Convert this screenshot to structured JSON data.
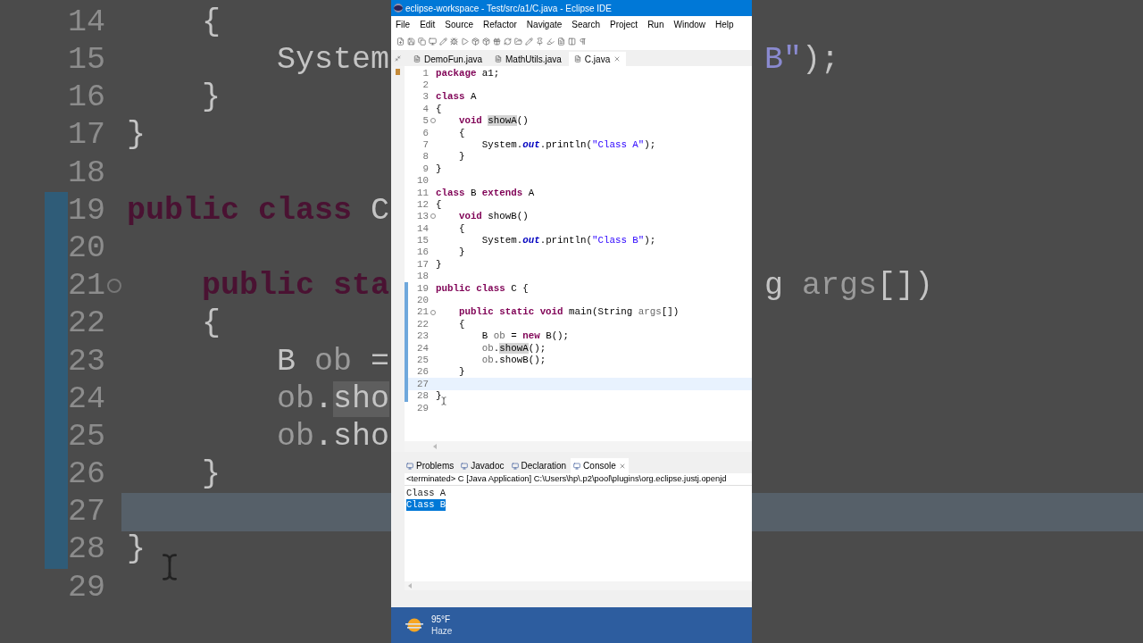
{
  "backdrop": {
    "left_lines": [
      {
        "number": "14",
        "fold": false,
        "changed": false,
        "current": false,
        "tokens": [
          {
            "text": "    {",
            "kind": "plain"
          }
        ]
      },
      {
        "number": "15",
        "fold": false,
        "changed": false,
        "current": false,
        "tokens": [
          {
            "text": "        System",
            "kind": "plain"
          }
        ]
      },
      {
        "number": "16",
        "fold": false,
        "changed": false,
        "current": false,
        "tokens": [
          {
            "text": "    }",
            "kind": "plain"
          }
        ]
      },
      {
        "number": "17",
        "fold": false,
        "changed": false,
        "current": false,
        "tokens": [
          {
            "text": "}",
            "kind": "plain"
          }
        ]
      },
      {
        "number": "18",
        "fold": false,
        "changed": false,
        "current": false
      },
      {
        "number": "19",
        "fold": false,
        "changed": true,
        "current": false,
        "tokens": [
          {
            "text": "public class",
            "kind": "keyword"
          },
          {
            "text": " C",
            "kind": "plain"
          }
        ]
      },
      {
        "number": "20",
        "fold": false,
        "changed": true,
        "current": false
      },
      {
        "number": "21",
        "fold": true,
        "changed": true,
        "current": false,
        "tokens": [
          {
            "text": "    public sta",
            "kind": "keyword"
          }
        ]
      },
      {
        "number": "22",
        "fold": false,
        "changed": true,
        "current": false,
        "tokens": [
          {
            "text": "    {",
            "kind": "plain"
          }
        ]
      },
      {
        "number": "23",
        "fold": false,
        "changed": true,
        "current": false,
        "tokens": [
          {
            "text": "        B ",
            "kind": "plain"
          },
          {
            "text": "ob",
            "kind": "local"
          },
          {
            "text": " =",
            "kind": "plain"
          }
        ]
      },
      {
        "number": "24",
        "fold": false,
        "changed": true,
        "current": false,
        "tokens": [
          {
            "text": "        ob",
            "kind": "local"
          },
          {
            "text": ".",
            "kind": "plain"
          },
          {
            "text": "sho",
            "kind": "occurrence"
          }
        ]
      },
      {
        "number": "25",
        "fold": false,
        "changed": true,
        "current": false,
        "tokens": [
          {
            "text": "        ob",
            "kind": "local"
          },
          {
            "text": ".sho",
            "kind": "plain"
          }
        ]
      },
      {
        "number": "26",
        "fold": false,
        "changed": true,
        "current": false,
        "tokens": [
          {
            "text": "    }",
            "kind": "plain"
          }
        ]
      },
      {
        "number": "27",
        "fold": false,
        "changed": true,
        "current": true
      },
      {
        "number": "28",
        "fold": false,
        "changed": true,
        "current": false,
        "tokens": [
          {
            "text": "}",
            "kind": "plain"
          }
        ]
      },
      {
        "number": "29",
        "fold": false,
        "changed": false,
        "current": false
      }
    ],
    "right_lines": [
      {
        "current": false
      },
      {
        "current": false,
        "tokens": [
          {
            "text": "B\"",
            "kind": "string"
          },
          {
            "text": ");",
            "kind": "plain"
          }
        ]
      },
      {
        "current": false
      },
      {
        "current": false
      },
      {
        "current": false
      },
      {
        "current": false
      },
      {
        "current": false
      },
      {
        "current": false,
        "tokens": [
          {
            "text": "g ",
            "kind": "plain"
          },
          {
            "text": "args",
            "kind": "local"
          },
          {
            "text": "[])",
            "kind": "plain"
          }
        ]
      },
      {
        "current": false
      },
      {
        "current": false
      },
      {
        "current": false
      },
      {
        "current": false
      },
      {
        "current": false
      },
      {
        "current": true
      },
      {
        "current": false
      },
      {
        "current": false
      }
    ]
  },
  "window": {
    "title": "eclipse-workspace - Test/src/a1/C.java - Eclipse IDE"
  },
  "menu": [
    "File",
    "Edit",
    "Source",
    "Refactor",
    "Navigate",
    "Search",
    "Project",
    "Run",
    "Window",
    "Help"
  ],
  "editor_tabs": [
    {
      "label": "DemoFun.java",
      "selected": false
    },
    {
      "label": "MathUtils.java",
      "selected": false
    },
    {
      "label": "C.java",
      "selected": true
    }
  ],
  "code": [
    {
      "number": "1",
      "fold": false,
      "changed": false,
      "current": false,
      "tokens": [
        {
          "text": "package",
          "kind": "keyword"
        },
        {
          "text": " a1;",
          "kind": "plain"
        }
      ]
    },
    {
      "number": "2",
      "fold": false,
      "changed": false,
      "current": false
    },
    {
      "number": "3",
      "fold": false,
      "changed": false,
      "current": false,
      "tokens": [
        {
          "text": "class",
          "kind": "keyword"
        },
        {
          "text": " A",
          "kind": "plain"
        }
      ]
    },
    {
      "number": "4",
      "fold": false,
      "changed": false,
      "current": false,
      "tokens": [
        {
          "text": "{",
          "kind": "plain"
        }
      ]
    },
    {
      "number": "5",
      "fold": true,
      "changed": false,
      "current": false,
      "tokens": [
        {
          "text": "    void ",
          "kind": "keyword"
        },
        {
          "text": "showA",
          "kind": "occurrence"
        },
        {
          "text": "()",
          "kind": "plain"
        }
      ]
    },
    {
      "number": "6",
      "fold": false,
      "changed": false,
      "current": false,
      "tokens": [
        {
          "text": "    {",
          "kind": "plain"
        }
      ]
    },
    {
      "number": "7",
      "fold": false,
      "changed": false,
      "current": false,
      "tokens": [
        {
          "text": "        System.",
          "kind": "plain"
        },
        {
          "text": "out",
          "kind": "field"
        },
        {
          "text": ".println(",
          "kind": "plain"
        },
        {
          "text": "\"Class A\"",
          "kind": "string"
        },
        {
          "text": ");",
          "kind": "plain"
        }
      ]
    },
    {
      "number": "8",
      "fold": false,
      "changed": false,
      "current": false,
      "tokens": [
        {
          "text": "    }",
          "kind": "plain"
        }
      ]
    },
    {
      "number": "9",
      "fold": false,
      "changed": false,
      "current": false,
      "tokens": [
        {
          "text": "}",
          "kind": "plain"
        }
      ]
    },
    {
      "number": "10",
      "fold": false,
      "changed": false,
      "current": false
    },
    {
      "number": "11",
      "fold": false,
      "changed": false,
      "current": false,
      "tokens": [
        {
          "text": "class",
          "kind": "keyword"
        },
        {
          "text": " B ",
          "kind": "plain"
        },
        {
          "text": "extends",
          "kind": "keyword"
        },
        {
          "text": " A",
          "kind": "plain"
        }
      ]
    },
    {
      "number": "12",
      "fold": false,
      "changed": false,
      "current": false,
      "tokens": [
        {
          "text": "{",
          "kind": "plain"
        }
      ]
    },
    {
      "number": "13",
      "fold": true,
      "changed": false,
      "current": false,
      "tokens": [
        {
          "text": "    void",
          "kind": "keyword"
        },
        {
          "text": " showB()",
          "kind": "plain"
        }
      ]
    },
    {
      "number": "14",
      "fold": false,
      "changed": false,
      "current": false,
      "tokens": [
        {
          "text": "    {",
          "kind": "plain"
        }
      ]
    },
    {
      "number": "15",
      "fold": false,
      "changed": false,
      "current": false,
      "tokens": [
        {
          "text": "        System.",
          "kind": "plain"
        },
        {
          "text": "out",
          "kind": "field"
        },
        {
          "text": ".println(",
          "kind": "plain"
        },
        {
          "text": "\"Class B\"",
          "kind": "string"
        },
        {
          "text": ");",
          "kind": "plain"
        }
      ]
    },
    {
      "number": "16",
      "fold": false,
      "changed": false,
      "current": false,
      "tokens": [
        {
          "text": "    }",
          "kind": "plain"
        }
      ]
    },
    {
      "number": "17",
      "fold": false,
      "changed": false,
      "current": false,
      "tokens": [
        {
          "text": "}",
          "kind": "plain"
        }
      ]
    },
    {
      "number": "18",
      "fold": false,
      "changed": false,
      "current": false
    },
    {
      "number": "19",
      "fold": false,
      "changed": true,
      "current": false,
      "tokens": [
        {
          "text": "public class",
          "kind": "keyword"
        },
        {
          "text": " C {",
          "kind": "plain"
        }
      ]
    },
    {
      "number": "20",
      "fold": false,
      "changed": true,
      "current": false
    },
    {
      "number": "21",
      "fold": true,
      "changed": true,
      "current": false,
      "tokens": [
        {
          "text": "    public static void",
          "kind": "keyword"
        },
        {
          "text": " main(String ",
          "kind": "plain"
        },
        {
          "text": "args",
          "kind": "local"
        },
        {
          "text": "[])",
          "kind": "plain"
        }
      ]
    },
    {
      "number": "22",
      "fold": false,
      "changed": true,
      "current": false,
      "tokens": [
        {
          "text": "    {",
          "kind": "plain"
        }
      ]
    },
    {
      "number": "23",
      "fold": false,
      "changed": true,
      "current": false,
      "tokens": [
        {
          "text": "        B ",
          "kind": "plain"
        },
        {
          "text": "ob",
          "kind": "local"
        },
        {
          "text": " = ",
          "kind": "plain"
        },
        {
          "text": "new",
          "kind": "keyword"
        },
        {
          "text": " B();",
          "kind": "plain"
        }
      ]
    },
    {
      "number": "24",
      "fold": false,
      "changed": true,
      "current": false,
      "tokens": [
        {
          "text": "        ob",
          "kind": "local"
        },
        {
          "text": ".",
          "kind": "plain"
        },
        {
          "text": "showA",
          "kind": "occurrence"
        },
        {
          "text": "();",
          "kind": "plain"
        }
      ]
    },
    {
      "number": "25",
      "fold": false,
      "changed": true,
      "current": false,
      "tokens": [
        {
          "text": "        ob",
          "kind": "local"
        },
        {
          "text": ".showB();",
          "kind": "plain"
        }
      ]
    },
    {
      "number": "26",
      "fold": false,
      "changed": true,
      "current": false,
      "tokens": [
        {
          "text": "    }",
          "kind": "plain"
        }
      ]
    },
    {
      "number": "27",
      "fold": false,
      "changed": true,
      "current": true
    },
    {
      "number": "28",
      "fold": false,
      "changed": true,
      "current": false,
      "tokens": [
        {
          "text": "}",
          "kind": "plain"
        }
      ]
    },
    {
      "number": "29",
      "fold": false,
      "changed": false,
      "current": false
    }
  ],
  "view_tabs": [
    {
      "label": "Problems",
      "selected": false
    },
    {
      "label": "Javadoc",
      "selected": false
    },
    {
      "label": "Declaration",
      "selected": false
    },
    {
      "label": "Console",
      "selected": true
    }
  ],
  "console": {
    "header": "<terminated> C [Java Application] C:\\Users\\hp\\.p2\\pool\\plugins\\org.eclipse.justj.openjd",
    "lines": [
      {
        "text": "Class A",
        "selected": false
      },
      {
        "text": "Class B",
        "selected": true
      }
    ]
  },
  "taskbar": {
    "temperature": "95°F",
    "condition": "Haze"
  }
}
